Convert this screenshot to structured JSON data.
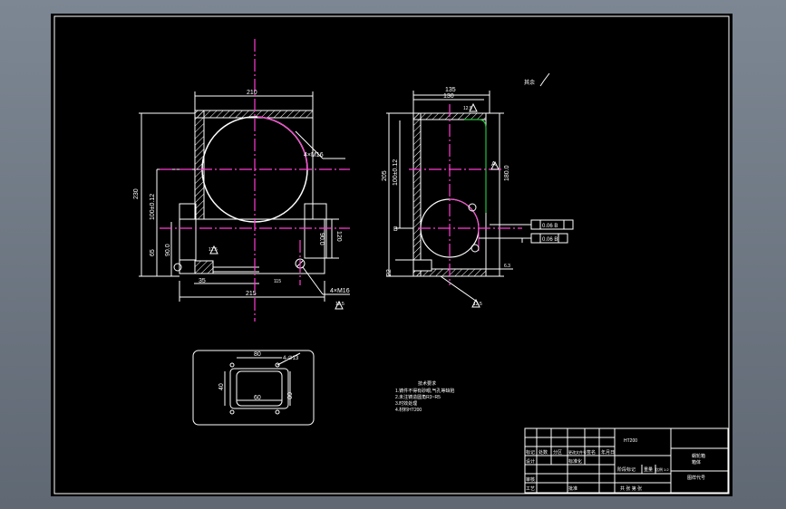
{
  "colors": {
    "line": "#ffffff",
    "center": "#ff3cd2",
    "dim": "#ffffff",
    "hatch": "#ffffff",
    "green": "#22c23a",
    "sheet": "#000000",
    "bg": "#6b7480"
  },
  "front_view": {
    "dim_top": "210",
    "dim_bottom": "215",
    "dim_height": "230",
    "dim_bore_center": "100±0.12",
    "dim_left_small_a": "65",
    "dim_left_small_b": "90.0",
    "dim_right_a": "120",
    "dim_right_b": "90.0",
    "dim_small_bottom": "35",
    "dim_small_bottom_b": "115",
    "hole_note_top": "4×M16",
    "hole_note_bottom": "4×M16",
    "roughness_a": "12.5",
    "roughness_b": "12.5"
  },
  "side_view": {
    "dim_top_outer": "135",
    "dim_top_inner": "130",
    "dim_height_a": "205",
    "dim_height_b": "100±0.12",
    "dim_right": "180.0",
    "dim_bottom_left": "22",
    "tol_1": "0.06 B",
    "tol_2": "0.06 B",
    "label_a": "A",
    "label_b": "B",
    "roughness_top": "12.5",
    "roughness_right": "6.3",
    "roughness_bottom": "12.5",
    "roughness_note": "其余"
  },
  "bottom_view": {
    "dim_top": "80",
    "dim_left": "40",
    "dim_right": "60",
    "dim_bottom": "60",
    "hole_note": "4-∅13"
  },
  "notes": {
    "title": "技术要求",
    "lines": [
      "1.铸件不得有砂眼,气孔等缺陷",
      "2.未注铸造圆角R3~R5",
      "3.时效处理",
      "4.材料HT200"
    ]
  },
  "title_block": {
    "material": "HT200",
    "part_name_a": "蜗轮箱",
    "part_name_b": "箱体",
    "drawing_no": "图样代号",
    "row_labels": [
      "标记",
      "处数",
      "分区",
      "更改文件号",
      "签名",
      "年月日"
    ],
    "design": "设计",
    "review": "审核",
    "process": "工艺",
    "stage_mark": "阶段标记",
    "weight": "重量",
    "scale": "比例",
    "scale_value": "1:2",
    "sheets": "共 张 第 张",
    "approve": "批准",
    "standard": "标准化"
  }
}
